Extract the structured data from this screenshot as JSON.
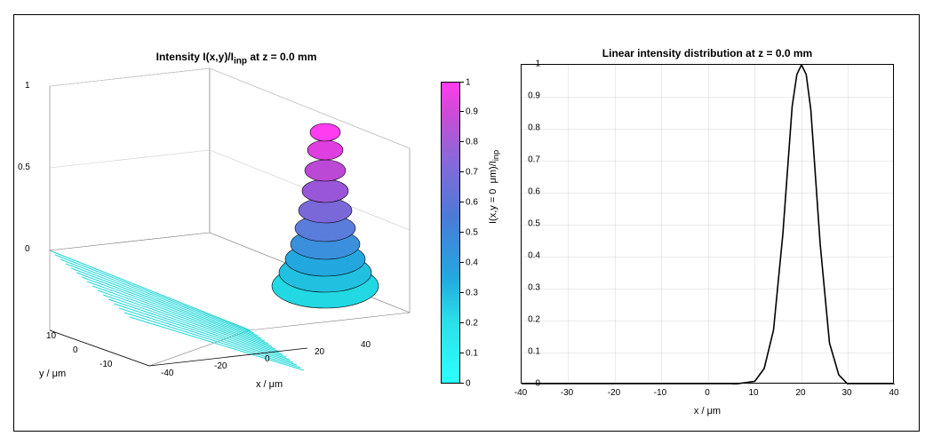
{
  "left": {
    "title": "Intensity I(x,y)/I_inp at z = 0.0 mm",
    "xlabel": "x / μm",
    "ylabel": "y / μm",
    "xticks": [
      "-40",
      "-20",
      "0",
      "20",
      "40"
    ],
    "yticks": [
      "-10",
      "0",
      "10"
    ],
    "zticks": [
      "0",
      "0.5",
      "1"
    ]
  },
  "colorbar": {
    "ticks": [
      "0",
      "0.1",
      "0.2",
      "0.3",
      "0.4",
      "0.5",
      "0.6",
      "0.7",
      "0.8",
      "0.9",
      "1"
    ]
  },
  "right": {
    "title": "Linear intensity distribution at z = 0.0 mm",
    "xlabel": "x / μm",
    "ylabel": "I(x,y = 0 μm)/I_inp",
    "xticks": [
      "-40",
      "-30",
      "-20",
      "-10",
      "0",
      "10",
      "20",
      "30",
      "40"
    ],
    "yticks": [
      "0",
      "0.1",
      "0.2",
      "0.3",
      "0.4",
      "0.5",
      "0.6",
      "0.7",
      "0.8",
      "0.9",
      "1"
    ]
  },
  "chart_data": [
    {
      "type": "surface",
      "title": "Intensity I(x,y)/I_inp at z = 0.0 mm",
      "xlabel": "x / μm",
      "ylabel": "y / μm",
      "zlabel": "I(x,y)/I_inp",
      "xlim": [
        -40,
        40
      ],
      "ylim": [
        -15,
        15
      ],
      "zlim": [
        0,
        1
      ],
      "peak_center": {
        "x": 20,
        "y": 0
      },
      "peak_value": 1.0,
      "fwhm_x": 10,
      "fwhm_y": 10,
      "description": "Gaussian-like intensity peak centered at x≈20 μm, y≈0 μm, normalized height 1, plotted with ~30 filled contour levels color-mapped 0→1."
    },
    {
      "type": "line",
      "title": "Linear intensity distribution at z = 0.0 mm",
      "xlabel": "x / μm",
      "ylabel": "I(x,y = 0 μm)/I_inp",
      "xlim": [
        -40,
        40
      ],
      "ylim": [
        0,
        1
      ],
      "x": [
        -40,
        -30,
        -20,
        -10,
        0,
        5,
        10,
        12,
        14,
        16,
        18,
        19,
        20,
        21,
        22,
        24,
        26,
        28,
        30,
        35,
        40
      ],
      "y": [
        0.0,
        0.0,
        0.0,
        0.0,
        0.0,
        0.0,
        0.01,
        0.05,
        0.17,
        0.47,
        0.87,
        0.97,
        1.0,
        0.97,
        0.86,
        0.44,
        0.13,
        0.03,
        0.0,
        0.0,
        0.0
      ]
    }
  ]
}
